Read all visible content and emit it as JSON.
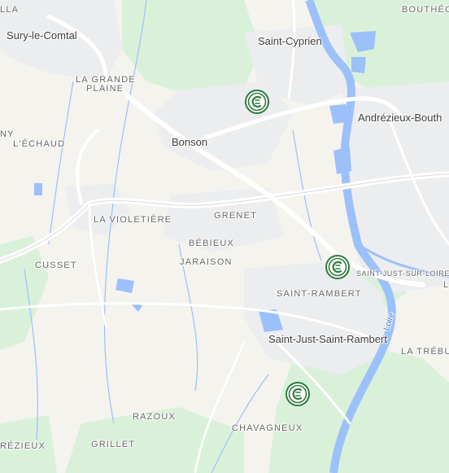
{
  "map": {
    "colors": {
      "land": "#f4f3ee",
      "urban": "#eceeef",
      "green": "#d7f0d7",
      "water": "#9cc0f9",
      "road": "#ffffff",
      "marker": "#2d7a3e"
    },
    "labels": {
      "sury_le_comtal": "Sury-le-Comtal",
      "saint_cyprien": "Saint-Cyprien",
      "bouthéon": "BOUTHÉO",
      "la_grande": "LA GRANDE",
      "plaine": "PLAINE",
      "andrezieux": "Andrézieux-Bouth",
      "bonson": "Bonson",
      "lechaud": "L'ÉCHAUD",
      "ny": "NY",
      "lla": "LLA",
      "la_violetiere": "LA VIOLETIÈRE",
      "grenet": "GRENET",
      "bebieux": "BÉBIEUX",
      "jaraison": "JARAISON",
      "cusset": "CUSSET",
      "saint_just_sur_loire": "SAINT-JUST-SUR-LOIRE",
      "l_edge": "L",
      "saint_rambert": "SAINT-RAMBERT",
      "saint_just_saint_rambert": "Saint-Just-Saint-Rambert",
      "loire": "Loire",
      "la_trebuc": "LA TRÉBUC",
      "razoux": "RAZOUX",
      "chavagneux": "CHAVAGNEUX",
      "grillet": "GRILLET",
      "rezieux": "RÉZIEUX"
    },
    "markers": [
      {
        "icon": "charging-station-icon"
      },
      {
        "icon": "charging-station-icon"
      },
      {
        "icon": "charging-station-icon"
      }
    ]
  }
}
